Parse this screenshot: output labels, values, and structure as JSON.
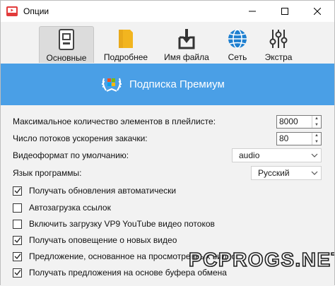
{
  "window": {
    "title": "Опции"
  },
  "toolbar": {
    "tabs": [
      {
        "label": "Основные",
        "icon": "general-settings-icon",
        "active": true
      },
      {
        "label": "Подробнее",
        "icon": "folder-icon",
        "active": false
      },
      {
        "label": "Имя файла",
        "icon": "download-file-icon",
        "active": false
      },
      {
        "label": "Сеть",
        "icon": "globe-icon",
        "active": false
      },
      {
        "label": "Экстра",
        "icon": "sliders-icon",
        "active": false
      }
    ]
  },
  "banner": {
    "text": "Подписка Премиум",
    "icon": "premium-laurel-icon",
    "color": "#4a9fe6"
  },
  "settings": {
    "max_items_label": "Максимальное количество элементов в плейлисте:",
    "max_items_value": "8000",
    "threads_label": "Число потоков ускорения закачки:",
    "threads_value": "80",
    "format_label": "Видеоформат по умолчанию:",
    "format_value": "audio",
    "language_label": "Язык программы:",
    "language_value": "Русский"
  },
  "checkboxes": [
    {
      "label": "Получать обновления автоматически",
      "checked": true
    },
    {
      "label": "Автозагрузка ссылок",
      "checked": false
    },
    {
      "label": "Включить загрузку VP9 YouTube видео потоков",
      "checked": false
    },
    {
      "label": "Получать оповещение о новых видео",
      "checked": true
    },
    {
      "label": "Предложение, основанное на просмотренных видео",
      "checked": true
    },
    {
      "label": "Получать предложения на основе буфера обмена",
      "checked": true
    }
  ],
  "watermark": {
    "text": "PCPROGS.NET"
  }
}
